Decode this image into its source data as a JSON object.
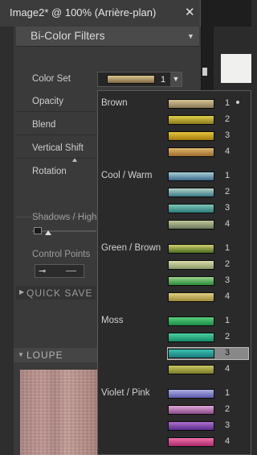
{
  "window": {
    "tab_title": "Image2* @ 100% (Arrière-plan)",
    "close_glyph": "✕"
  },
  "panel": {
    "title": "Bi-Color Filters",
    "properties": [
      {
        "label": "Color Set"
      },
      {
        "label": "Opacity"
      },
      {
        "label": "Blend"
      },
      {
        "label": "Vertical Shift"
      },
      {
        "label": "Rotation"
      }
    ],
    "shadows_label": "Shadows / Highli",
    "control_points_label": "Control Points",
    "quick_save_label": "QUICK SAVE",
    "loupe_label": "LOUPE"
  },
  "color_set": {
    "selected_number": "1",
    "selected_colors": [
      "#7d6a44",
      "#d9c48c"
    ]
  },
  "dropdown": {
    "groups": [
      {
        "name": "Brown",
        "items": [
          {
            "num": "1",
            "colors": [
              "#8a7a55",
              "#d4c493"
            ],
            "current": true
          },
          {
            "num": "2",
            "colors": [
              "#8a7a1e",
              "#e0d048"
            ]
          },
          {
            "num": "3",
            "colors": [
              "#a27a10",
              "#e6c63a"
            ]
          },
          {
            "num": "4",
            "colors": [
              "#9a6a2a",
              "#e0b870"
            ]
          }
        ]
      },
      {
        "name": "Cool / Warm",
        "items": [
          {
            "num": "1",
            "colors": [
              "#3a6a8a",
              "#a8d0d8"
            ]
          },
          {
            "num": "2",
            "colors": [
              "#3a7a8a",
              "#b4d4c4"
            ]
          },
          {
            "num": "3",
            "colors": [
              "#2a7a78",
              "#7ec8b8"
            ]
          },
          {
            "num": "4",
            "colors": [
              "#6a7a5a",
              "#c0c89a"
            ]
          }
        ]
      },
      {
        "name": "Green / Brown",
        "items": [
          {
            "num": "1",
            "colors": [
              "#4a6a20",
              "#d0d070"
            ]
          },
          {
            "num": "2",
            "colors": [
              "#8a9a6a",
              "#dcdcaa"
            ]
          },
          {
            "num": "3",
            "colors": [
              "#2a8a3a",
              "#9ad48a"
            ]
          },
          {
            "num": "4",
            "colors": [
              "#9a8a3a",
              "#e0d080"
            ]
          }
        ]
      },
      {
        "name": "Moss",
        "items": [
          {
            "num": "1",
            "colors": [
              "#1a8a4a",
              "#5ad07a"
            ]
          },
          {
            "num": "2",
            "colors": [
              "#1a8a6a",
              "#4ad0a0"
            ]
          },
          {
            "num": "3",
            "colors": [
              "#1a7a7a",
              "#3ac0b0"
            ],
            "highlighted": true
          },
          {
            "num": "4",
            "colors": [
              "#7a7a2a",
              "#c8c860"
            ]
          }
        ]
      },
      {
        "name": "Violet / Pink",
        "items": [
          {
            "num": "1",
            "colors": [
              "#5a5aaa",
              "#b0b0e8"
            ]
          },
          {
            "num": "2",
            "colors": [
              "#8a4a8a",
              "#e0a8d8"
            ]
          },
          {
            "num": "3",
            "colors": [
              "#5a2a8a",
              "#b070d0"
            ]
          },
          {
            "num": "4",
            "colors": [
              "#aa2a6a",
              "#f070a8"
            ]
          }
        ]
      }
    ]
  }
}
